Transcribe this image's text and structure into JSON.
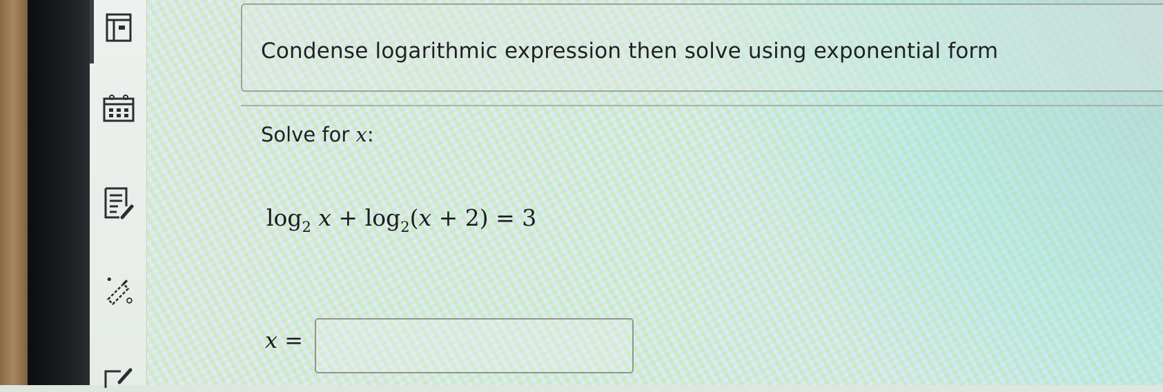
{
  "sidebar": {
    "items": [
      {
        "icon": "panel-icon"
      },
      {
        "icon": "calendar-icon"
      },
      {
        "icon": "notes-edit-icon"
      },
      {
        "icon": "pencil-icon"
      },
      {
        "icon": "edit-icon"
      }
    ]
  },
  "question": {
    "title": "Condense logarithmic expression then solve using exponential form",
    "prompt_text": "Solve for ",
    "prompt_var": "x",
    "prompt_colon": ":"
  },
  "equation": {
    "log1": "log",
    "base1": "2",
    "var1": "x",
    "plus": " + ",
    "log2": "log",
    "base2": "2",
    "open": "(",
    "var2": "x",
    "plus2": " + 2",
    "close": ")",
    "equals": " = 3"
  },
  "answer": {
    "label_var": "x",
    "label_eq": " =",
    "value": "",
    "placeholder": ""
  }
}
